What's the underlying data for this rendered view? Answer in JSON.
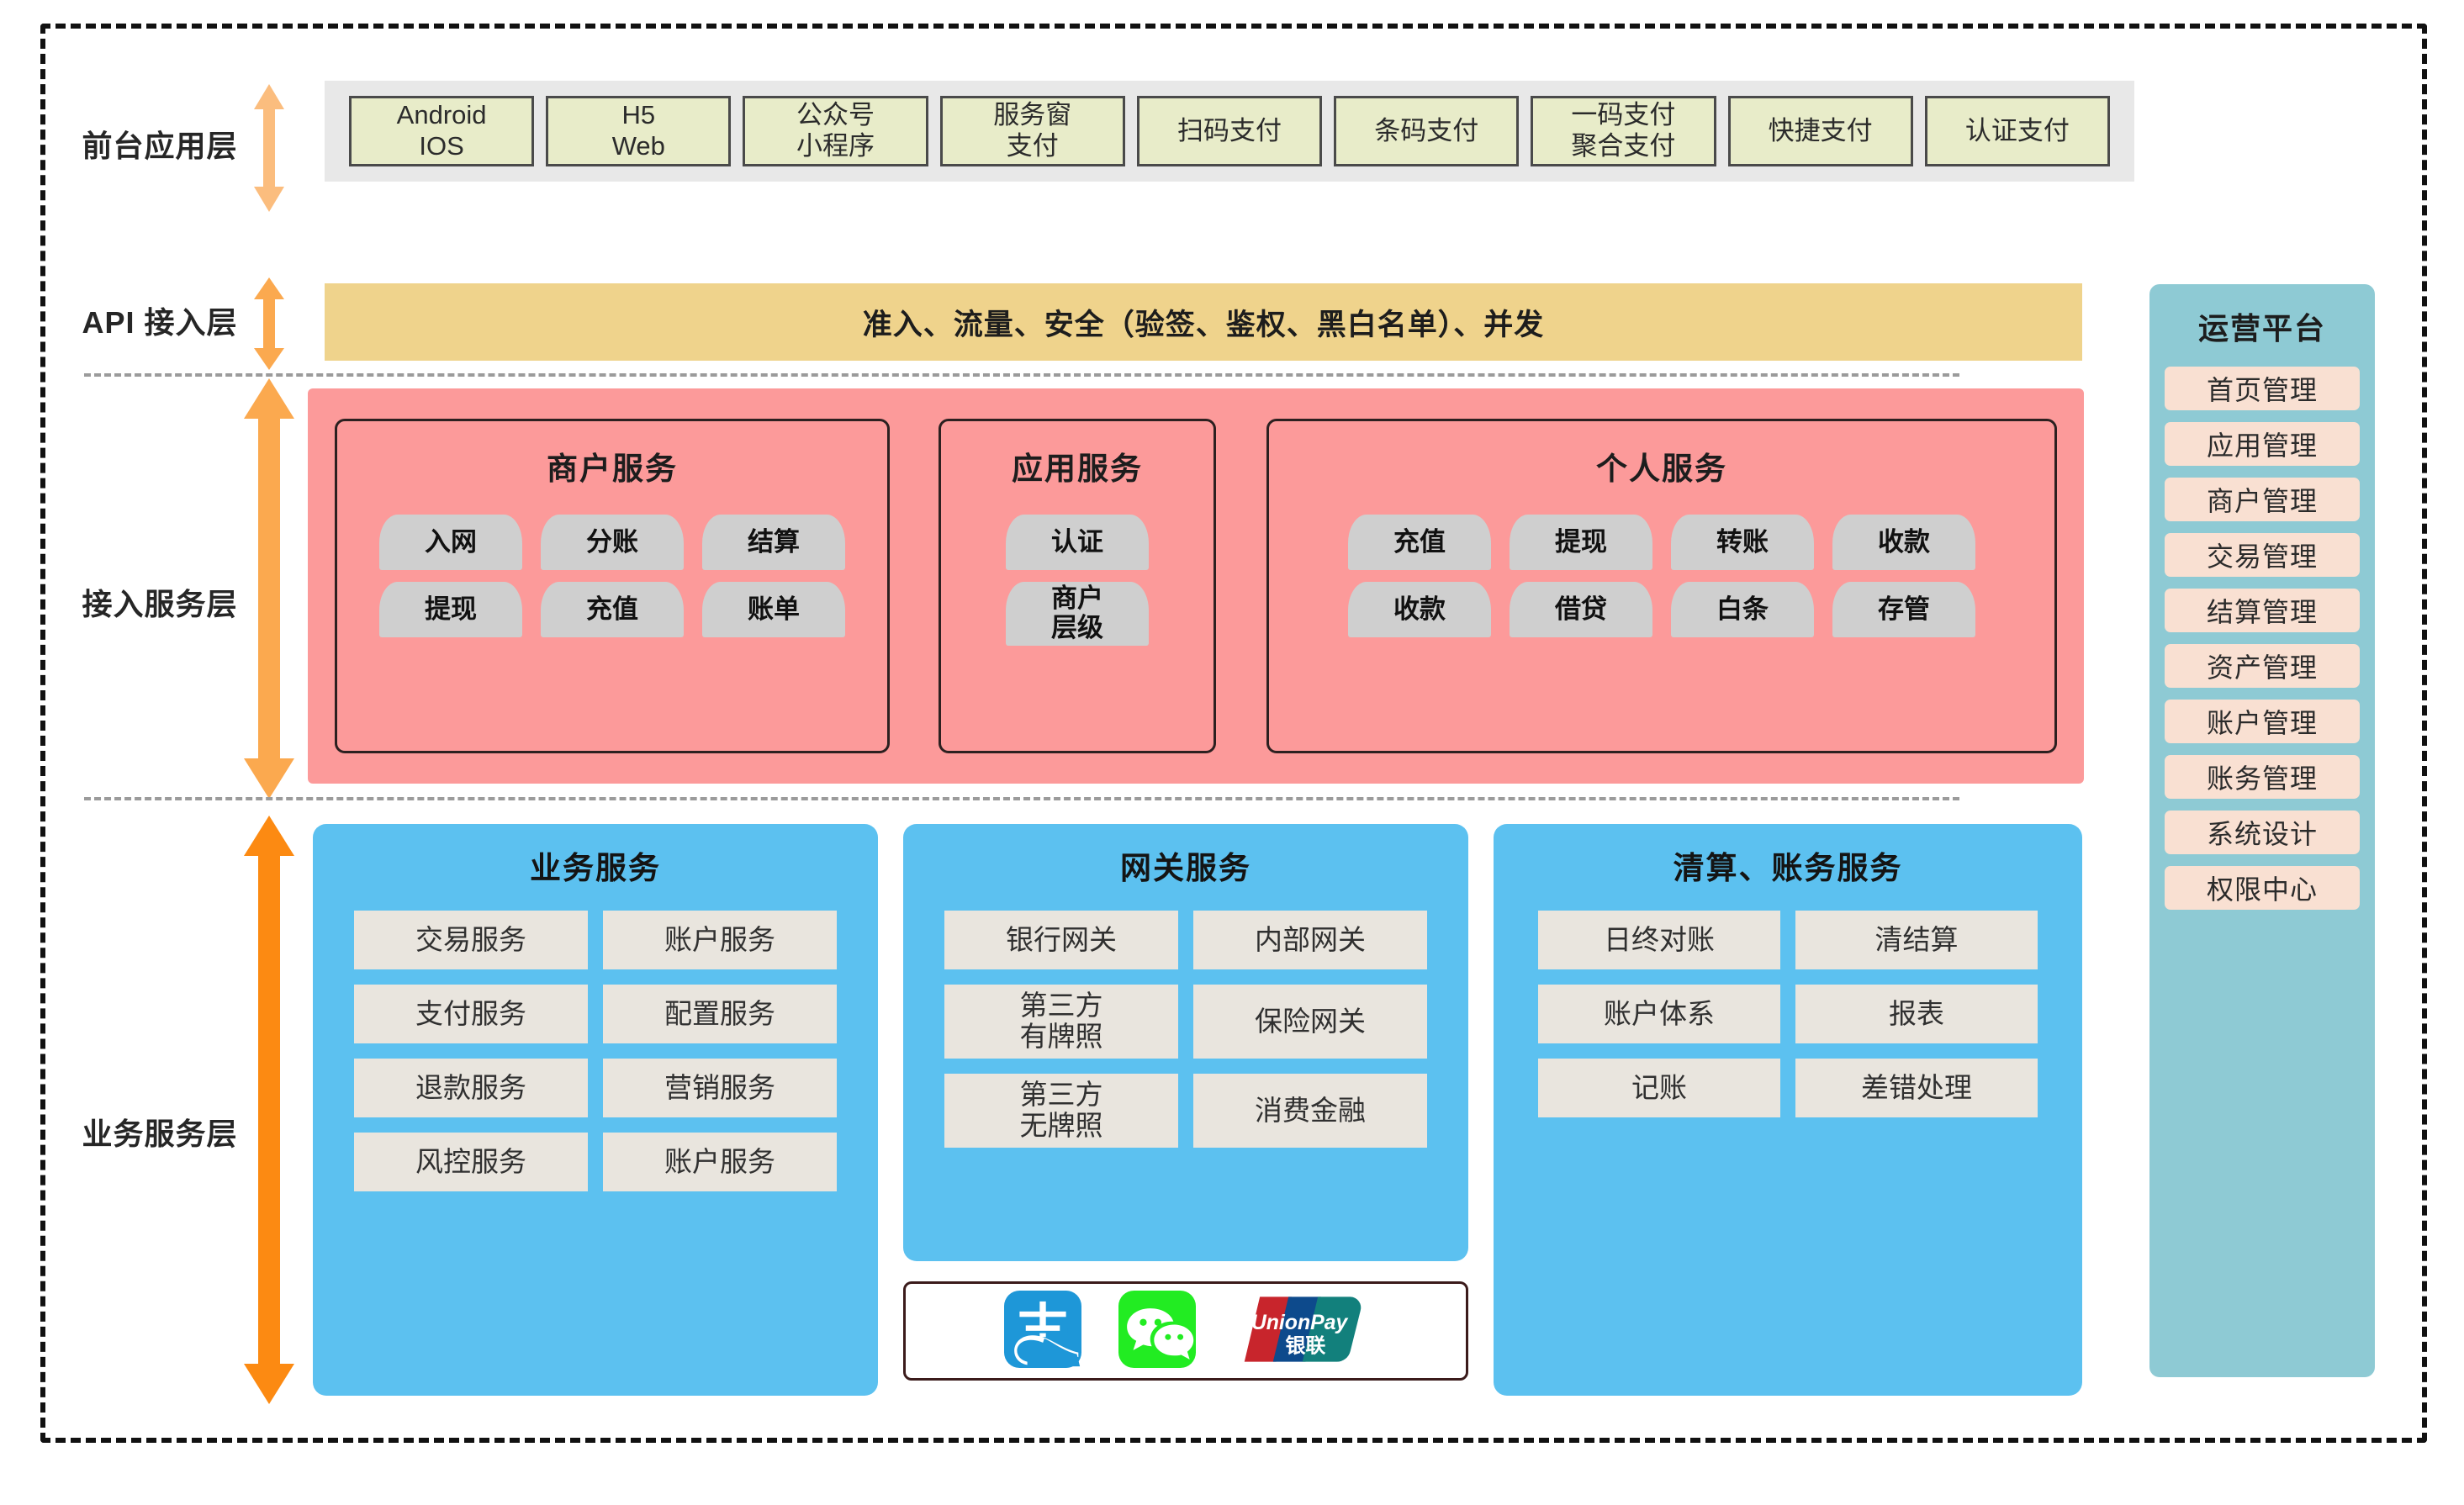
{
  "layers": {
    "frontend": {
      "label": "前台应用层"
    },
    "api": {
      "label": "API 接入层",
      "band_text": "准入、流量、安全（验签、鉴权、黑白名单）、并发"
    },
    "access": {
      "label": "接入服务层"
    },
    "business": {
      "label": "业务服务层"
    }
  },
  "app_boxes": [
    {
      "line1": "Android",
      "line2": "IOS"
    },
    {
      "line1": "H5",
      "line2": "Web"
    },
    {
      "line1": "公众号",
      "line2": "小程序"
    },
    {
      "line1": "服务窗",
      "line2": "支付"
    },
    {
      "line1": "扫码支付",
      "line2": ""
    },
    {
      "line1": "条码支付",
      "line2": ""
    },
    {
      "line1": "一码支付",
      "line2": "聚合支付"
    },
    {
      "line1": "快捷支付",
      "line2": ""
    },
    {
      "line1": "认证支付",
      "line2": ""
    }
  ],
  "access_cards": [
    {
      "title": "商户服务",
      "chips": [
        "入网",
        "分账",
        "结算",
        "提现",
        "充值",
        "账单"
      ]
    },
    {
      "title": "应用服务",
      "chips": [
        "认证",
        "商户\n层级"
      ]
    },
    {
      "title": "个人服务",
      "chips": [
        "充值",
        "提现",
        "转账",
        "收款",
        "收款",
        "借贷",
        "白条",
        "存管"
      ]
    }
  ],
  "business_panels": [
    {
      "title": "业务服务",
      "tiles": [
        "交易服务",
        "账户服务",
        "支付服务",
        "配置服务",
        "退款服务",
        "营销服务",
        "风控服务",
        "账户服务"
      ]
    },
    {
      "title": "网关服务",
      "tiles": [
        "银行网关",
        "内部网关",
        "第三方\n有牌照",
        "保险网关",
        "第三方\n无牌照",
        "消费金融"
      ]
    },
    {
      "title": "清算、账务服务",
      "tiles": [
        "日终对账",
        "清结算",
        "账户体系",
        "报表",
        "记账",
        "差错处理"
      ]
    }
  ],
  "payment_logos": [
    {
      "name": "alipay",
      "label": "支付宝"
    },
    {
      "name": "wechat-pay",
      "label": "微信支付"
    },
    {
      "name": "unionpay",
      "label": "UnionPay 银联"
    }
  ],
  "unionpay": {
    "latin": "UnionPay",
    "cn": "银联"
  },
  "ops_platform": {
    "title": "运营平台",
    "items": [
      "首页管理",
      "应用管理",
      "商户管理",
      "交易管理",
      "结算管理",
      "资产管理",
      "账户管理",
      "账务管理",
      "系统设计",
      "权限中心"
    ]
  },
  "colors": {
    "app_strip_bg": "#e8e8e8",
    "app_box_bg": "#e8ecc9",
    "api_band_bg": "#efd38c",
    "access_layer_bg": "#fc9a9a",
    "chip_bg": "#cfcfcf",
    "business_panel_bg": "#5cc1f0",
    "tile_bg": "#e9e5de",
    "ops_panel_bg": "#8ecad4",
    "ops_item_bg": "#f9e0d2",
    "arrow_light": "#fbbd7e",
    "arrow_mid": "#fba94f",
    "arrow_strong": "#fc8a12",
    "alipay": "#1e97d8",
    "wechat": "#22ec22",
    "unionpay_red": "#c8252c",
    "unionpay_navy": "#0d4a8c",
    "unionpay_teal": "#12807c"
  }
}
